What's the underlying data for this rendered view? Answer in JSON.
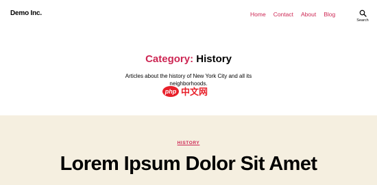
{
  "header": {
    "site_title": "Demo Inc.",
    "menu": [
      "Home",
      "Contact",
      "About",
      "Blog"
    ],
    "search_label": "Search"
  },
  "archive": {
    "title_prefix": "Category:",
    "title_name": "History",
    "description_line1": "Articles about the history of New York City and all its",
    "description_line2": "neighborhoods."
  },
  "watermark": {
    "logo": "php",
    "text": "中文网"
  },
  "post": {
    "category": "HISTORY",
    "title": "Lorem Ipsum Dolor Sit Amet"
  },
  "colors": {
    "accent": "#cd2653",
    "post_background": "#f5efe0"
  }
}
